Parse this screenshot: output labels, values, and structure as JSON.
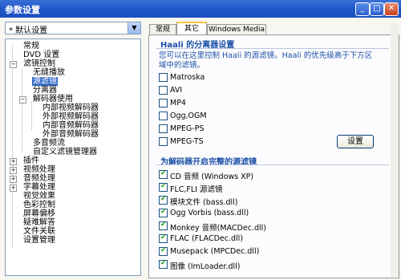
{
  "window": {
    "title": "参数设置"
  },
  "left": {
    "preset": "* 默认设置",
    "tree": [
      {
        "label": "常规"
      },
      {
        "label": "DVD 设置"
      },
      {
        "label": "滤镜控制"
      },
      {
        "label": "无缝播放"
      },
      {
        "label": "源滤镜"
      },
      {
        "label": "分离器"
      },
      {
        "label": "解码器使用"
      },
      {
        "label": "内部视频解码器"
      },
      {
        "label": "外部视频解码器"
      },
      {
        "label": "内部音频解码器"
      },
      {
        "label": "外部音频解码器"
      },
      {
        "label": "多音频流"
      },
      {
        "label": "自定义滤镜管理器"
      },
      {
        "label": "插件"
      },
      {
        "label": "视频处理"
      },
      {
        "label": "音频处理"
      },
      {
        "label": "字幕处理"
      },
      {
        "label": "视觉效果"
      },
      {
        "label": "色彩控制"
      },
      {
        "label": "屏幕偏移"
      },
      {
        "label": "疑难解答"
      },
      {
        "label": "文件关联"
      },
      {
        "label": "设置管理"
      }
    ]
  },
  "tabs": [
    {
      "label": "常规"
    },
    {
      "label": "其它"
    },
    {
      "label": "Windows Media"
    }
  ],
  "splitter_group": {
    "title": "Haali 的分离器设置",
    "description_line1": "您可以在这里控制 Haali 的源滤镜。Haali 的优先级高于下方区",
    "description_line2": "域中的滤镜。",
    "items": [
      {
        "label": "Matroska",
        "checked": false
      },
      {
        "label": "AVI",
        "checked": false
      },
      {
        "label": "MP4",
        "checked": false
      },
      {
        "label": "Ogg,OGM",
        "checked": false
      },
      {
        "label": "MPEG-PS",
        "checked": false
      },
      {
        "label": "MPEG-TS",
        "checked": false
      }
    ],
    "settings_button": "设置"
  },
  "decoder_group": {
    "title": "为解码器开启完整的源滤镜",
    "items": [
      {
        "label": "CD 音频 (Windows XP)",
        "checked": true
      },
      {
        "label": "FLC,FLI 源滤镜",
        "checked": true
      },
      {
        "label": "模块文件 (bass.dll)",
        "checked": true
      },
      {
        "label": "Ogg Vorbis (bass.dll)",
        "checked": true
      },
      {
        "label": "Monkey 音频(MACDec.dll)",
        "checked": true
      },
      {
        "label": "FLAC (FLACDec.dll)",
        "checked": true
      },
      {
        "label": "Musepack (MPCDec.dll)",
        "checked": true
      },
      {
        "label": "图像 (ImLoader.dll)",
        "checked": true
      }
    ]
  }
}
